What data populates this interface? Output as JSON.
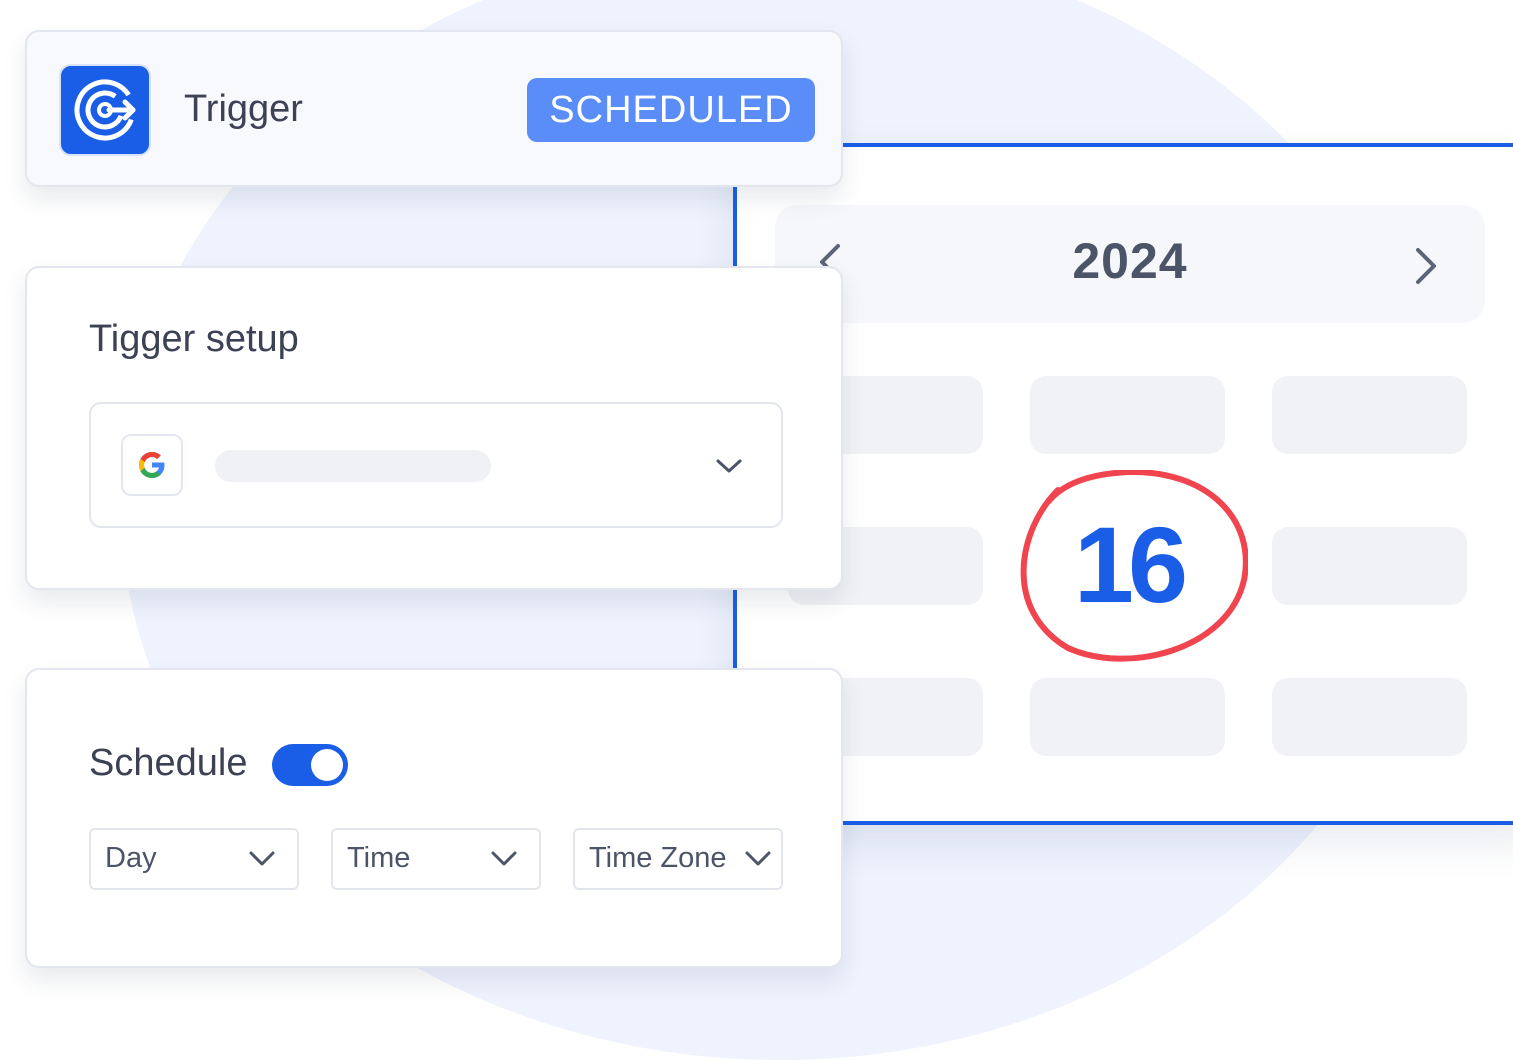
{
  "trigger_card": {
    "title": "Trigger",
    "badge": "SCHEDULED",
    "app_icon": "target-arrow-icon"
  },
  "setup_card": {
    "title": "Tigger setup",
    "provider_icon": "google-icon",
    "select_icon": "chevron-down-icon"
  },
  "schedule_card": {
    "title": "Schedule",
    "toggle_on": true,
    "dropdowns": [
      {
        "label": "Day"
      },
      {
        "label": "Time"
      },
      {
        "label": "Time Zone"
      }
    ]
  },
  "calendar": {
    "year": "2024",
    "highlighted_date": "16",
    "prev_icon": "chevron-left-icon",
    "next_icon": "chevron-right-icon"
  },
  "colors": {
    "accent": "#1a5ee8",
    "badge": "#5a8df8",
    "highlight_circle": "#f0454f"
  }
}
